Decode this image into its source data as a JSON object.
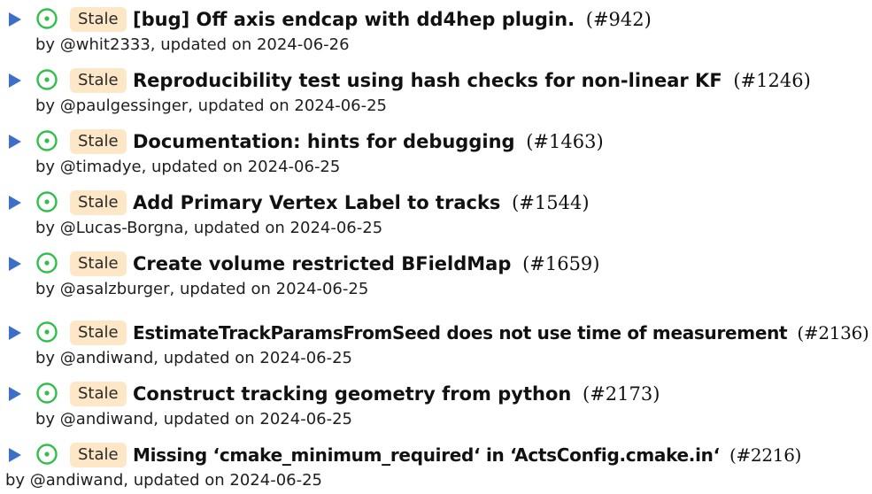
{
  "colors": {
    "expander": "#3e6fc8",
    "status_open": "#2fbf4a",
    "stale_badge_bg": "#fde7c7"
  },
  "icons": {
    "expander": "triangle-right-icon",
    "status": "open-issue-circle-icon"
  },
  "issues": [
    {
      "badge": "Stale",
      "title": "[bug] Off axis endcap with dd4hep plugin.",
      "number": "(#942)",
      "meta": "by @whit2333, updated on 2024-06-26"
    },
    {
      "badge": "Stale",
      "title": "Reproducibility test using hash checks for non-linear KF",
      "number": "(#1246)",
      "meta": "by @paulgessinger, updated on 2024-06-25"
    },
    {
      "badge": "Stale",
      "title": "Documentation: hints for debugging",
      "number": "(#1463)",
      "meta": "by @timadye, updated on 2024-06-25"
    },
    {
      "badge": "Stale",
      "title": "Add Primary Vertex Label to tracks",
      "number": "(#1544)",
      "meta": "by @Lucas-Borgna, updated on 2024-06-25"
    },
    {
      "badge": "Stale",
      "title": "Create volume restricted BFieldMap",
      "number": "(#1659)",
      "meta": "by @asalzburger, updated on 2024-06-25"
    },
    {
      "badge": "Stale",
      "title": "EstimateTrackParamsFromSeed does not use time of measurement",
      "number": "(#2136)",
      "meta": "by @andiwand, updated on 2024-06-25"
    },
    {
      "badge": "Stale",
      "title": "Construct tracking geometry from python",
      "number": "(#2173)",
      "meta": "by @andiwand, updated on 2024-06-25"
    },
    {
      "badge": "Stale",
      "title": "Missing ‘cmake_minimum_required‘ in ‘ActsConfig.cmake.in‘",
      "number": "(#2216)",
      "meta": "by @andiwand, updated on 2024-06-25"
    }
  ]
}
